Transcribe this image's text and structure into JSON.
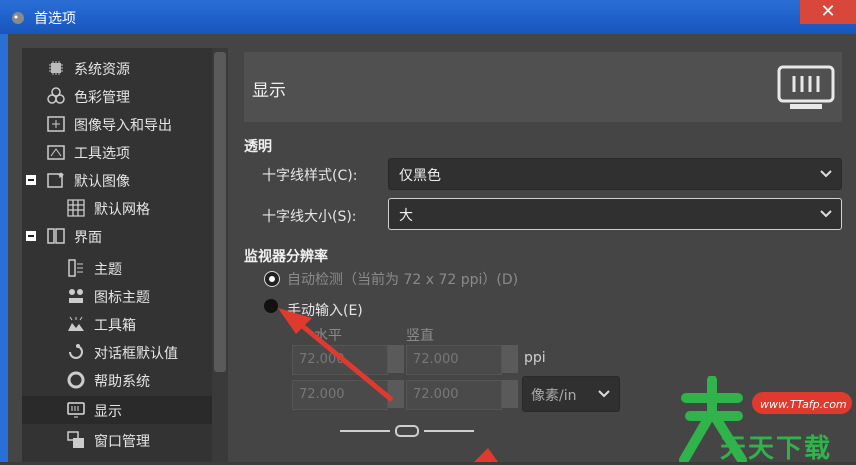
{
  "window": {
    "title": "首选项",
    "close_glyph": "✕"
  },
  "sidebar": {
    "items": [
      {
        "label": "系统资源",
        "icon": "chip-icon"
      },
      {
        "label": "色彩管理",
        "icon": "color-circles-icon"
      },
      {
        "label": "图像导入和导出",
        "icon": "image-import-icon"
      },
      {
        "label": "工具选项",
        "icon": "tool-options-icon"
      },
      {
        "label": "默认图像",
        "icon": "default-image-icon",
        "expanded": true
      },
      {
        "label": "默认网格",
        "icon": "grid-icon"
      },
      {
        "label": "界面",
        "icon": "interface-icon",
        "expanded": true
      },
      {
        "label": "主题",
        "icon": "theme-icon"
      },
      {
        "label": "图标主题",
        "icon": "icon-theme-icon"
      },
      {
        "label": "工具箱",
        "icon": "toolbox-icon"
      },
      {
        "label": "对话框默认值",
        "icon": "dialog-defaults-icon"
      },
      {
        "label": "帮助系统",
        "icon": "help-lifebuoy-icon"
      },
      {
        "label": "显示",
        "icon": "display-icon",
        "selected": true
      },
      {
        "label": "窗口管理",
        "icon": "window-management-icon"
      }
    ]
  },
  "panel": {
    "title": "显示",
    "transparency": {
      "heading": "透明",
      "crosshair_style_label": "十字线样式(C):",
      "crosshair_style_value": "仅黑色",
      "crosshair_size_label": "十字线大小(S):",
      "crosshair_size_value": "大"
    },
    "resolution": {
      "heading": "监视器分辨率",
      "auto_label": "自动检测（当前为 72 x 72 ppi）(D)",
      "manual_label": "手动输入(E)",
      "horizontal_label": "水平",
      "vertical_label": "竖直",
      "h_value_1": "72.000",
      "v_value_1": "72.000",
      "h_value_2": "72.000",
      "v_value_2": "72.000",
      "unit_label": "ppi",
      "unit_combo": "像素/in"
    }
  },
  "watermark": {
    "url": "www.TTafp.com",
    "text": "天天下载"
  },
  "colors": {
    "titlebar": "#1e5fc9",
    "close": "#d9473a",
    "watermark_green": "#2fb34a",
    "arrow_red": "#e03a2f"
  }
}
